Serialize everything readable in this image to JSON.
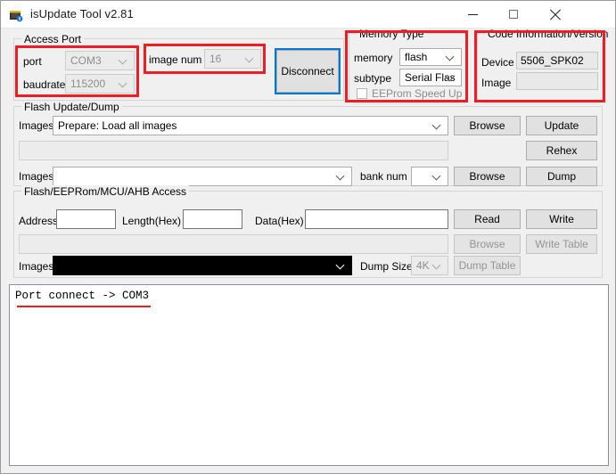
{
  "window": {
    "title": "isUpdate Tool v2.81",
    "icon": "chip-icon",
    "minimize": "minimize-icon",
    "maximize": "maximize-icon",
    "close": "close-icon"
  },
  "accent": {
    "annotation_red": "#ef1c22",
    "focus_blue": "#0078d7"
  },
  "access_port": {
    "legend": "Access Port",
    "port_label": "port",
    "port_value": "COM3",
    "baudrate_label": "baudrate",
    "baudrate_value": "115200",
    "image_num_label": "image num",
    "image_num_value": "16",
    "connect_button": "Disconnect"
  },
  "memory_type": {
    "legend": "Memory Type",
    "memory_label": "memory",
    "memory_value": "flash",
    "subtype_label": "subtype",
    "subtype_value": "Serial Flas",
    "eeprom_speedup_label": "EEProm Speed Up",
    "eeprom_speedup_checked": false
  },
  "code_information": {
    "legend": "Code Information/Version",
    "device_label": "Device",
    "device_value": "5506_SPK02",
    "image_label": "Image",
    "image_value": ""
  },
  "flash_update_dump": {
    "legend": "Flash Update/Dump",
    "images1_label": "Images",
    "images1_value": "Prepare: Load all images",
    "path_value": "",
    "images2_label": "Images",
    "images2_value": "",
    "bank_num_label": "bank num",
    "bank_num_value": "",
    "browse1": "Browse",
    "browse2": "Browse",
    "update": "Update",
    "rehex": "Rehex",
    "dump": "Dump"
  },
  "access_section": {
    "legend": "Flash/EEPRom/MCU/AHB Access",
    "address_label": "Address",
    "address_value": "",
    "length_label": "Length(Hex)",
    "length_value": "",
    "data_label": "Data(Hex)",
    "data_value": "",
    "path_value": "",
    "images_label": "Images",
    "images_value": "",
    "dump_size_label": "Dump Size",
    "dump_size_value": "4K",
    "read": "Read",
    "write": "Write",
    "browse": "Browse",
    "write_table": "Write Table",
    "dump_table": "Dump Table"
  },
  "log": {
    "lines": [
      "Port connect -> COM3"
    ]
  }
}
